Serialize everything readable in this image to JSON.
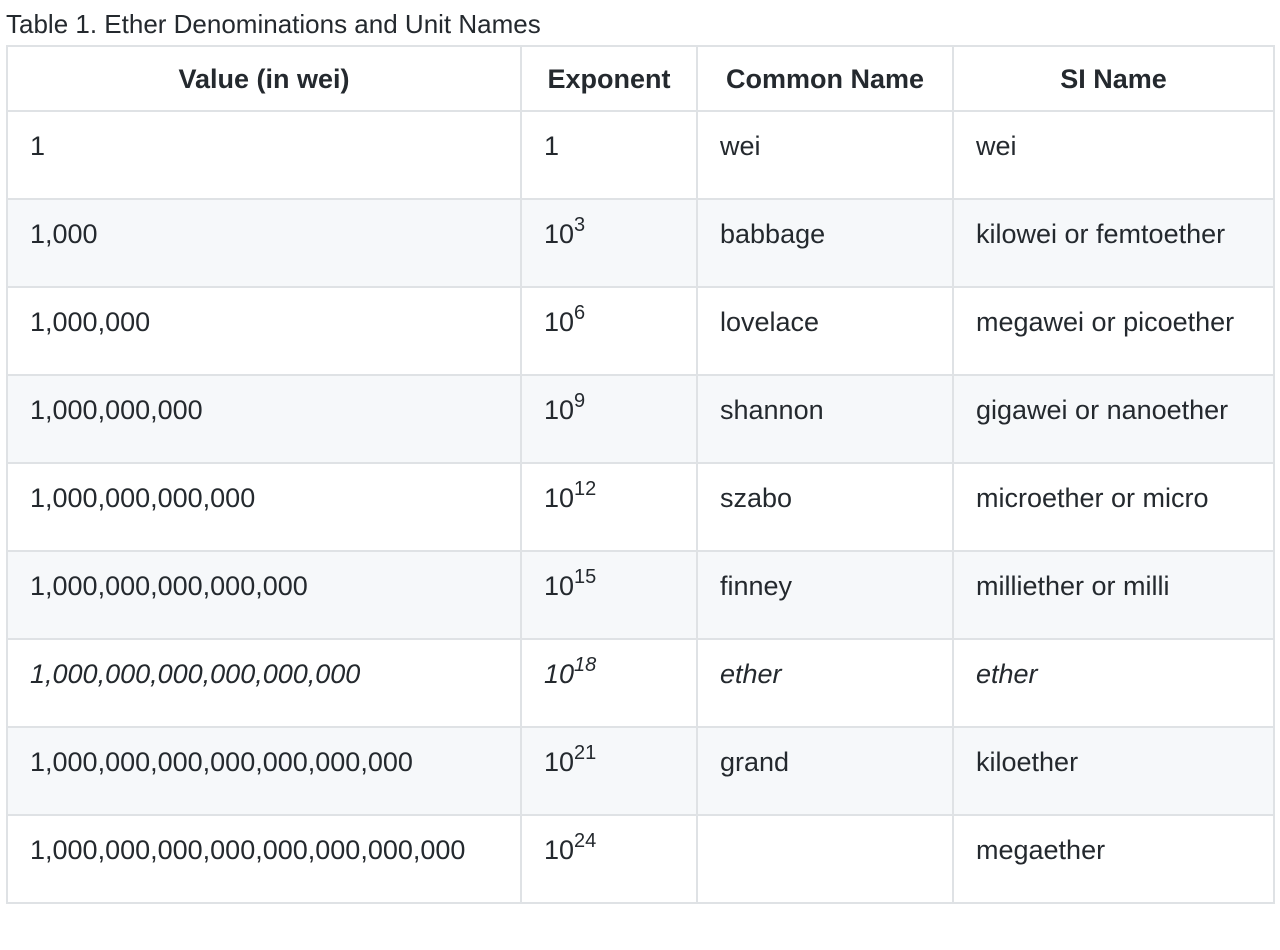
{
  "caption": "Table 1. Ether Denominations and Unit Names",
  "headers": {
    "value": "Value (in wei)",
    "exponent": "Exponent",
    "common_name": "Common Name",
    "si_name": "SI Name"
  },
  "rows": [
    {
      "value": "1",
      "exp_base": "1",
      "exp_power": "",
      "common": "wei",
      "si": "wei"
    },
    {
      "value": "1,000",
      "exp_base": "10",
      "exp_power": "3",
      "common": "babbage",
      "si": "kilowei or femtoether"
    },
    {
      "value": "1,000,000",
      "exp_base": "10",
      "exp_power": "6",
      "common": "lovelace",
      "si": "megawei or picoether"
    },
    {
      "value": "1,000,000,000",
      "exp_base": "10",
      "exp_power": "9",
      "common": "shannon",
      "si": "gigawei or nanoether"
    },
    {
      "value": "1,000,000,000,000",
      "exp_base": "10",
      "exp_power": "12",
      "common": "szabo",
      "si": "microether or micro"
    },
    {
      "value": "1,000,000,000,000,000",
      "exp_base": "10",
      "exp_power": "15",
      "common": "finney",
      "si": "milliether or milli"
    },
    {
      "value": "1,000,000,000,000,000,000",
      "exp_base": "10",
      "exp_power": "18",
      "common": "ether",
      "si": "ether",
      "emphasis": true
    },
    {
      "value": "1,000,000,000,000,000,000,000",
      "exp_base": "10",
      "exp_power": "21",
      "common": "grand",
      "si": "kiloether"
    },
    {
      "value": "1,000,000,000,000,000,000,000,000",
      "exp_base": "10",
      "exp_power": "24",
      "common": "",
      "si": "megaether"
    }
  ]
}
